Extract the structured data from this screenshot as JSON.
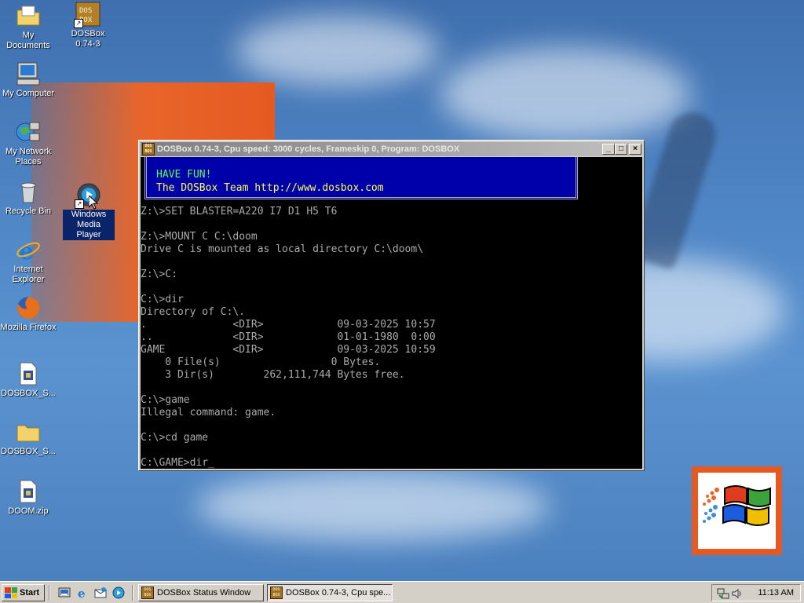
{
  "desktop": {
    "icons": [
      {
        "label": "My Documents",
        "icon": "my-documents-icon"
      },
      {
        "label": "DOSBox 0.74-3",
        "icon": "dosbox-icon"
      },
      {
        "label": "My Computer",
        "icon": "my-computer-icon"
      },
      {
        "label": "My Network Places",
        "icon": "network-places-icon"
      },
      {
        "label": "Recycle Bin",
        "icon": "recycle-bin-icon"
      },
      {
        "label": "Windows Media Player",
        "icon": "media-player-icon"
      },
      {
        "label": "Internet Explorer",
        "icon": "internet-explorer-icon"
      },
      {
        "label": "Mozilla Firefox",
        "icon": "firefox-icon"
      },
      {
        "label": "DOSBOX_S...",
        "icon": "settings-file-icon"
      },
      {
        "label": "DOSBOX_S...",
        "icon": "folder-icon"
      },
      {
        "label": "DOOM.zip",
        "icon": "zip-file-icon"
      }
    ]
  },
  "dosbox_window": {
    "title": "DOSBox 0.74-3, Cpu speed:     3000 cycles, Frameskip  0, Program:   DOSBOX",
    "buttons": {
      "minimize": "_",
      "maximize": "□",
      "close": "×"
    },
    "banner": {
      "line1": "HAVE FUN!",
      "line2": "The DOSBox Team http://www.dosbox.com"
    },
    "console_lines": [
      "Z:\\>SET BLASTER=A220 I7 D1 H5 T6",
      "",
      "Z:\\>MOUNT C C:\\doom",
      "Drive C is mounted as local directory C:\\doom\\",
      "",
      "Z:\\>C:",
      "",
      "C:\\>dir",
      "Directory of C:\\.",
      ".              <DIR>            09-03-2025 10:57",
      "..             <DIR>            01-01-1980  0:00",
      "GAME           <DIR>            09-03-2025 10:59",
      "    0 File(s)                  0 Bytes.",
      "    3 Dir(s)        262,111,744 Bytes free.",
      "",
      "C:\\>game",
      "Illegal command: game.",
      "",
      "C:\\>cd game",
      "",
      "C:\\GAME>dir_"
    ]
  },
  "taskbar": {
    "start_label": "Start",
    "quick_launch": [
      "show-desktop-icon",
      "internet-explorer-icon",
      "outlook-express-icon",
      "media-player-icon"
    ],
    "tasks": [
      {
        "label": "DOSBox Status Window",
        "active": false
      },
      {
        "label": "DOSBox 0.74-3, Cpu spe...",
        "active": true
      }
    ],
    "tray_icons": [
      "network-icon",
      "volume-icon"
    ],
    "clock": "11:13 AM"
  },
  "colors": {
    "console_bg": "#000000",
    "console_text": "#aaaaaa",
    "banner_bg": "#0000aa",
    "banner_fun": "#55ff55",
    "banner_team": "#ffff55",
    "selection": "#0a246a"
  }
}
